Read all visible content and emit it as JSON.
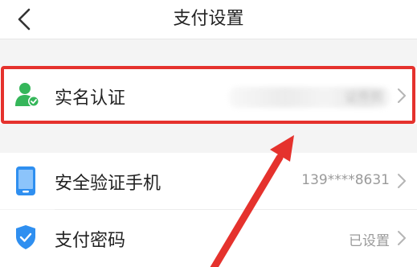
{
  "header": {
    "title": "支付设置",
    "back_icon": "chevron-left-icon"
  },
  "rows": [
    {
      "label": "实名认证",
      "value": "证件照",
      "icon": "person-verified-icon",
      "icon_color": "#35b65a"
    },
    {
      "label": "安全验证手机",
      "value": "139****8631",
      "icon": "phone-icon",
      "icon_color": "#2f8ff0"
    },
    {
      "label": "支付密码",
      "value": "已设置",
      "icon": "shield-check-icon",
      "icon_color": "#2f8ff0"
    }
  ],
  "annotation": {
    "highlight_color": "#e5322d",
    "arrow_color": "#e5322d"
  }
}
